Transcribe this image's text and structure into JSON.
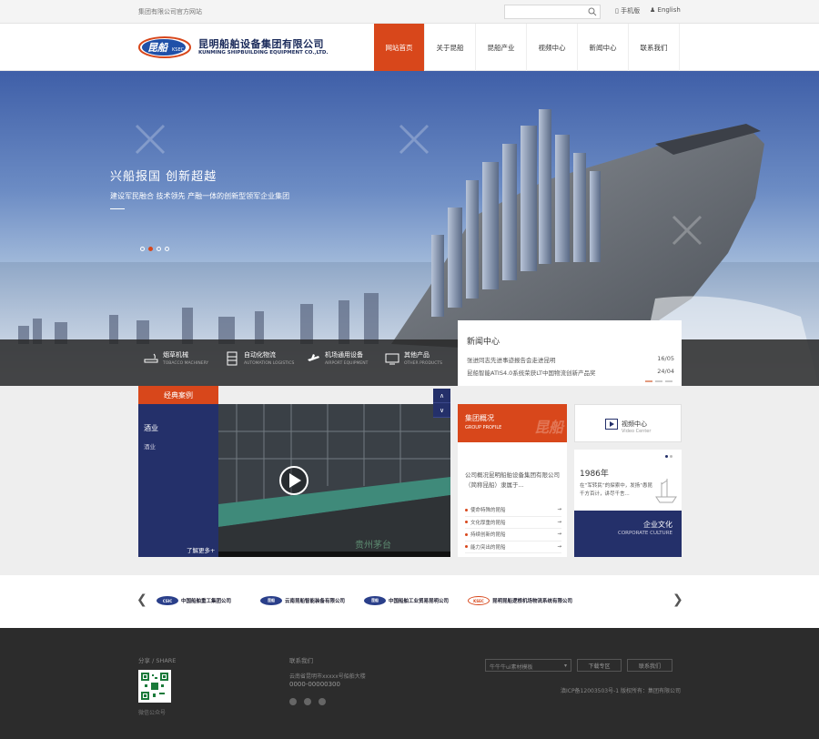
{
  "topbar": {
    "site_text": "集团有限公司官方网站",
    "search_placeholder": "",
    "mobile_label": "手机版",
    "english_label": "English"
  },
  "header": {
    "logo_cn": "昆明船舶设备集团有限公司",
    "logo_en": "KUNMING SHIPBUILDING EQUIPMENT CO.,LTD.",
    "logo_mark_text": "昆船",
    "logo_mark_sub": "KSEC",
    "nav": [
      {
        "label": "网站首页",
        "active": true
      },
      {
        "label": "关于昆船",
        "active": false
      },
      {
        "label": "昆船产业",
        "active": false
      },
      {
        "label": "视频中心",
        "active": false
      },
      {
        "label": "新闻中心",
        "active": false
      },
      {
        "label": "联系我们",
        "active": false
      }
    ]
  },
  "banner": {
    "headline": "兴船报国 创新超越",
    "subline": "建设军民融合 技术领先 产融一体的创新型领军企业集团",
    "slide_count": 4,
    "active_slide": 1,
    "industries": [
      {
        "name": "烟草机械",
        "en": "TOBACCO MACHINERY",
        "icon": "cigarette-icon"
      },
      {
        "name": "自动化物流",
        "en": "AUTOMATION LOGISTICS",
        "icon": "warehouse-icon"
      },
      {
        "name": "机场通用设备",
        "en": "AIRPORT EQUIPMENT",
        "icon": "airplane-icon"
      },
      {
        "name": "其他产品",
        "en": "OTHER PRODUCTS",
        "icon": "monitor-icon"
      }
    ]
  },
  "news": {
    "title": "新闻中心",
    "items": [
      {
        "text": "张进同志先进事迹报告会走进昆明",
        "date": "16/05"
      },
      {
        "text": "昆船智能ATIS4.0系统荣获LT中国物流创新产品奖",
        "date": "24/04"
      }
    ]
  },
  "cases": {
    "tab_label": "经典案例",
    "category": "酒业",
    "sub": "酒业",
    "more_label": "了解更多+",
    "video_caption": "贵州茅台"
  },
  "profile": {
    "title": "集团概况",
    "title_en": "GROUP PROFILE",
    "watermark": "昆船",
    "description": "公司概况昆明船舶设备集团有限公司（简称昆船）隶属于...",
    "links": [
      "使命特殊的昆船",
      "文化厚重的昆船",
      "持续创新的昆船",
      "能力突出的昆船"
    ]
  },
  "video_center": {
    "title": "视频中心",
    "title_en": "Video Center"
  },
  "history": {
    "year": "1986年",
    "text": "在“军转民”的探索中，发扬“愚昆千方百计，讲尽千言..."
  },
  "culture": {
    "title": "企业文化",
    "title_en": "CORPORATE CULTURE"
  },
  "partners": [
    {
      "logo": "CSIC",
      "name": "中国船舶重工集团公司"
    },
    {
      "logo": "昆船",
      "name": "云南昆船智能装备有限公司"
    },
    {
      "logo": "昆船",
      "name": "中国船舶工业贸易昆明公司"
    },
    {
      "logo": "KSEC",
      "name": "昆明昆船逻根机场物流系统有限公司"
    }
  ],
  "footer": {
    "share_label": "分享 / SHARE",
    "qr_caption": "微信公众号",
    "contact_label": "联系我们",
    "address": "云南省昆明市xxxxx号船舶大楼",
    "phone": "0000-00000300",
    "template_select": "牛牛牛ui素材模板",
    "download_label": "下载专区",
    "contact_btn_label": "联系我们",
    "icp": "滇ICP备12003503号-1 版权所有：集团有限公司"
  },
  "colors": {
    "accent": "#d8471b",
    "navy": "#24306a",
    "footer_bg": "#2c2c2c"
  }
}
